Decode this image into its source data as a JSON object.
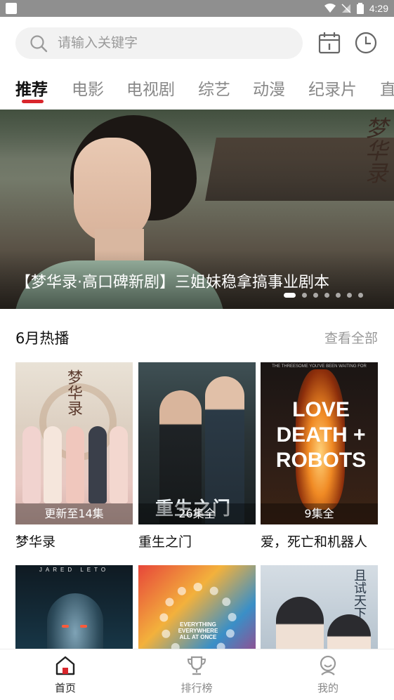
{
  "status_bar": {
    "time": "4:29"
  },
  "search": {
    "placeholder": "请输入关键字"
  },
  "header_icons": [
    "calendar-icon",
    "history-icon"
  ],
  "tabs": [
    {
      "label": "推荐",
      "active": true
    },
    {
      "label": "电影",
      "active": false
    },
    {
      "label": "电视剧",
      "active": false
    },
    {
      "label": "综艺",
      "active": false
    },
    {
      "label": "动漫",
      "active": false
    },
    {
      "label": "纪录片",
      "active": false
    },
    {
      "label": "直",
      "active": false
    }
  ],
  "banner": {
    "caption": "【梦华录·高口碑新剧】三姐妹稳拿搞事业剧本",
    "calligraphy": "梦华录",
    "slide_count": 7,
    "active_slide": 1
  },
  "section": {
    "title": "6月热播",
    "more_label": "查看全部"
  },
  "cards": [
    {
      "title": "梦华录",
      "badge": "更新至14集",
      "poster_text": "梦华录"
    },
    {
      "title": "重生之门",
      "badge": "26集全",
      "poster_text": "重生之门"
    },
    {
      "title": "爱，死亡和机器人",
      "badge": "9集全",
      "poster_text": "LOVE DEATH + ROBOTS",
      "poster_tagline": "THE THREESOME YOU'VE BEEN WAITING FOR"
    },
    {
      "title": "",
      "badge": "",
      "poster_text": "JARED LETO"
    },
    {
      "title": "",
      "badge": "",
      "poster_text": "EVERYTHING EVERYWHERE ALL AT ONCE"
    },
    {
      "title": "",
      "badge": "",
      "poster_text": "且试天下"
    }
  ],
  "bottom_nav": [
    {
      "label": "首页",
      "icon": "home-icon",
      "active": true
    },
    {
      "label": "排行榜",
      "icon": "trophy-icon",
      "active": false
    },
    {
      "label": "我的",
      "icon": "profile-icon",
      "active": false
    }
  ],
  "colors": {
    "accent": "#d9262c",
    "muted_text": "#999999",
    "search_bg": "#f2f2f2"
  }
}
